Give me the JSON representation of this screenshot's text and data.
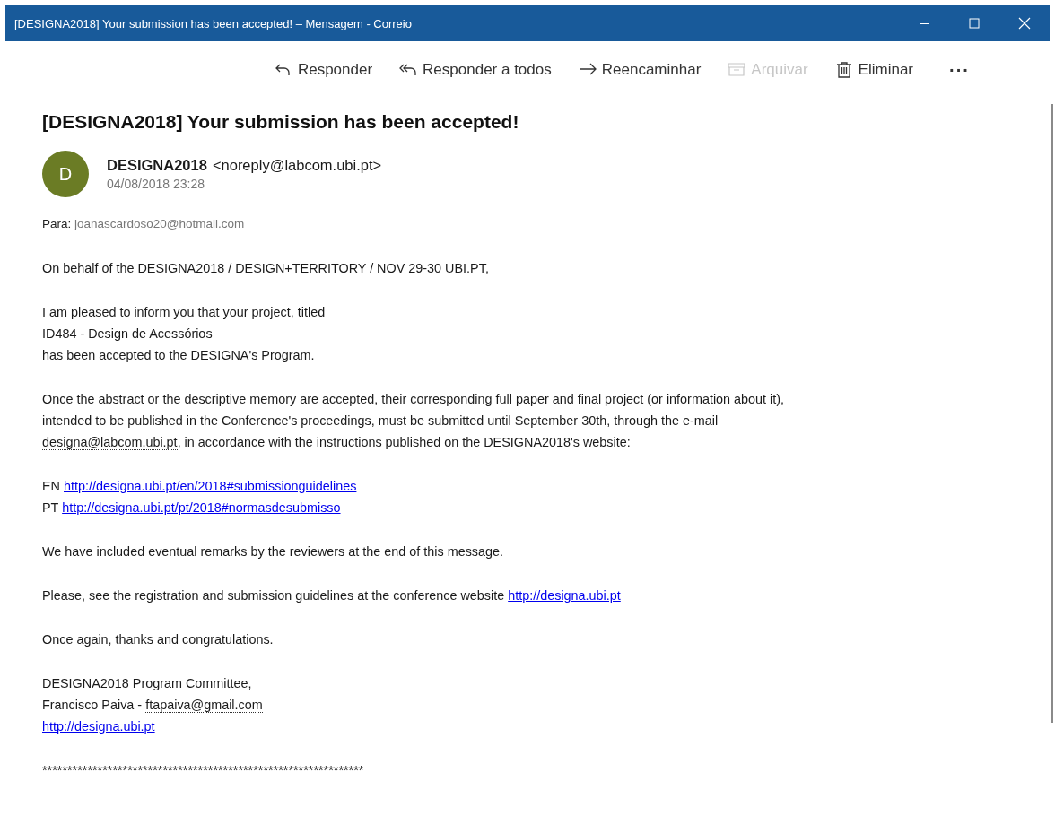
{
  "window": {
    "title": "[DESIGNA2018] Your submission has been accepted! – Mensagem - Correio"
  },
  "toolbar": [
    {
      "kind": "reply",
      "label": "Responder",
      "disabled": false
    },
    {
      "kind": "reply-all",
      "label": "Responder a todos",
      "disabled": false
    },
    {
      "kind": "forward",
      "label": "Reencaminhar",
      "disabled": false
    },
    {
      "kind": "archive",
      "label": "Arquivar",
      "disabled": true
    },
    {
      "kind": "delete",
      "label": "Eliminar",
      "disabled": false
    },
    {
      "kind": "more",
      "label": "···",
      "disabled": false
    }
  ],
  "message": {
    "subject": "[DESIGNA2018] Your submission has been accepted!",
    "sender": {
      "initial": "D",
      "name": "DESIGNA2018",
      "address": "<noreply@labcom.ubi.pt>",
      "date": "04/08/2018 23:28"
    },
    "to_label": "Para:",
    "to": "joanascardoso20@hotmail.com",
    "body": [
      [
        [
          {
            "kind": "text",
            "text": "On behalf of the DESIGNA2018 / DESIGN+TERRITORY / NOV 29-30 UBI.PT,"
          }
        ]
      ],
      [
        [
          {
            "kind": "text",
            "text": "I am pleased to inform you that your project, titled"
          }
        ],
        [
          {
            "kind": "text",
            "text": "ID484 - Design de Acessórios"
          }
        ],
        [
          {
            "kind": "text",
            "text": "has been accepted to the DESIGNA's Program."
          }
        ]
      ],
      [
        [
          {
            "kind": "text",
            "text": "Once the abstract or the descriptive memory are accepted, their corresponding full paper and final project (or information about it),"
          }
        ],
        [
          {
            "kind": "text",
            "text": "intended to be published in the Conference's proceedings, must be submitted until September 30th, through the e-mail"
          }
        ],
        [
          {
            "kind": "dotted",
            "text": "designa@labcom.ubi.pt"
          },
          {
            "kind": "text",
            "text": ", in accordance with the instructions published on the DESIGNA2018's website:"
          }
        ]
      ],
      [
        [
          {
            "kind": "text",
            "text": "EN "
          },
          {
            "kind": "link",
            "text": "http://designa.ubi.pt/en/2018#submissionguidelines"
          }
        ],
        [
          {
            "kind": "text",
            "text": "PT "
          },
          {
            "kind": "link",
            "text": "http://designa.ubi.pt/pt/2018#normasdesubmisso"
          }
        ]
      ],
      [
        [
          {
            "kind": "text",
            "text": "We have included eventual remarks by the reviewers at the end of this message."
          }
        ]
      ],
      [
        [
          {
            "kind": "text",
            "text": "Please, see the registration and submission guidelines at the conference website "
          },
          {
            "kind": "link",
            "text": "http://designa.ubi.pt"
          }
        ]
      ],
      [
        [
          {
            "kind": "text",
            "text": "Once again, thanks and congratulations."
          }
        ]
      ],
      [
        [
          {
            "kind": "text",
            "text": "DESIGNA2018 Program Committee,"
          }
        ],
        [
          {
            "kind": "text",
            "text": "Francisco Paiva - "
          },
          {
            "kind": "dotted",
            "text": "ftapaiva@gmail.com"
          }
        ],
        [
          {
            "kind": "link",
            "text": "http://designa.ubi.pt"
          }
        ]
      ],
      [
        [
          {
            "kind": "text",
            "text": "****************************************************************"
          }
        ]
      ]
    ]
  }
}
